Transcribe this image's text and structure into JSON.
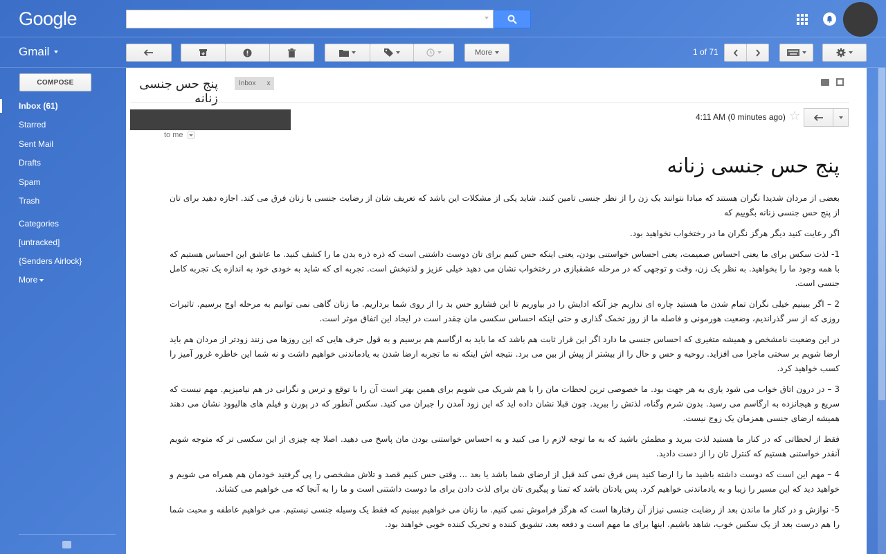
{
  "app": {
    "logo": "Google",
    "product": "Gmail"
  },
  "search": {
    "value": "",
    "placeholder": ""
  },
  "toolbar": {
    "more_label": "More",
    "pager": "1 of 71"
  },
  "sidebar": {
    "compose": "COMPOSE",
    "items": [
      {
        "label": "Inbox (61)"
      },
      {
        "label": "Starred"
      },
      {
        "label": "Sent Mail"
      },
      {
        "label": "Drafts"
      },
      {
        "label": "Spam"
      },
      {
        "label": "Trash"
      },
      {
        "label": "Categories"
      },
      {
        "label": "[untracked]"
      },
      {
        "label": "{Senders Airlock}"
      },
      {
        "label": "More"
      }
    ]
  },
  "message": {
    "subject": "پنج حس جنسی زنانه",
    "tag": "Inbox",
    "tag_close": "x",
    "to": "to me",
    "timestamp": "4:11 AM (0 minutes ago)",
    "body_title": "پنج حس جنسی زنانه",
    "paragraphs": [
      "بعضی از مردان شدیدا نگران هستند که مبادا نتوانند یک زن را از نظر جنسی تامین کنند. شاید یکی از مشکلات این باشد که  تعریف شان از رضایت جنسی با زنان فرق می کند. اجازه دهید برای تان از پنج حس جنسی زنانه بگوییم که",
      "اگر رعایت کنید دیگر هرگز نگران ما در رختخواب نخواهید بود.",
      "1- لذت سکس برای ما یعنی احساس صمیمت، یعنی احساس خواستنی بودن، یعنی اینکه حس کنیم برای تان دوست داشتنی  است که ذره ذره بدن ما را کشف کنید. ما عاشق این احساس هستیم که با همه وجود ما را بخواهید. به نظر یک زن، وقت و توجهی که در مرحله عشقبازی در رختخواب نشان می دهید خیلی عزیز و لذتبخش است. تجربه ای که شاید به خودی خود به اندازه یک تجربه کامل جنسی است.",
      "2 – اگر ببینیم خیلی نگران تمام شدن ما هستید چاره ای نداریم جز آنکه ادایش را در بیاوریم تا این فشارو حس بد را از روی شما برداریم. ما زنان گاهی نمی توانیم به مرحله اوج برسیم. تاثیرات روزی که از سر گذراندیم، وضعیت هورمونی و فاصله ما از روز تخمک گذاری و حتی اینکه احساس سکسی مان چقدر است در ایجاد این اتفاق موثر است.",
      "در این وضعیت نامشخص و همیشه متغیری که احساس جنسی ما دارد اگر این قرار ثابت هم باشد که ما باید به ارگاسم هم برسیم و به قول حرف هایی که این روزها می زنند زودتر از مردان هم باید ارضا شویم بر سختی ماجرا می افزاید. روحیه و حس و حال را از بیشتر از پیش از بین می برد. نتیجه اش اینکه نه ما تجربه ارضا شدن به یادماندنی خواهیم داشت و نه شما این خاطره غرور آمیز را کسب خواهید کرد.",
      "3 – در درون اتاق خواب می شود یاری به هر جهت بود. ما خصوصی ترین لحظات مان را با هم شریک می شویم برای همین بهتر است آن را با توقع و ترس و نگرانی در هم نیامیزیم. مهم نیست که سریع و هیجانزده به ارگاسم می رسید. بدون شرم وگناه، لذتش را ببرید. چون قبلا نشان داده اید که این زود آمدن را جبران می کنید. سکس آنطور که در پورن و فیلم های هالیوود نشان می دهند همیشه ارضای جنسی همزمان یک زوج نیست.",
      "فقط از لحظاتی که در کنار ما هستید لذت ببرید و مطمئن باشید که  به ما توجه لازم را می کنید و به احساس خواستنی بودن مان پاسخ می دهید. اصلا  چه چیزی از این سکسی تر که متوجه شویم آنقدر خواستنی هستیم که کنترل تان را از دست دادید.",
      "4 – مهم این است که دوست داشته باشید ما را ارضا کنید پس فرق نمی کند قبل از ارضای شما باشد یا بعد ... وقتی حس کنیم قصد و تلاش مشخصی را پی گرفتید خودمان هم همراه می شویم و خواهید دید که این مسیر را زیبا و به یادماندنی خواهیم کرد. پس یادتان باشد که تمنا و پیگیری تان برای لذت دادن برای ما دوست داشتنی است و ما را به آنجا که می خواهیم می کشاند.",
      "5- نوازش و در کنار ما ماندن بعد از رضایت جنسی نیزاز آن رفتارها است که هرگز فراموش نمی کنیم. ما زنان می خواهیم ببینیم که فقط یک وسیله جنسی نیستیم. می خواهیم عاطفه و محبت شما را هم درست بعد از یک سکس خوب، شاهد باشیم. اینها برای ما مهم است و دفعه بعد، تشویق کننده و تحریک کننده خوبی خواهند بود."
    ]
  },
  "colors": {
    "accent": "#4d90fe",
    "background": "#4a7fd6"
  }
}
